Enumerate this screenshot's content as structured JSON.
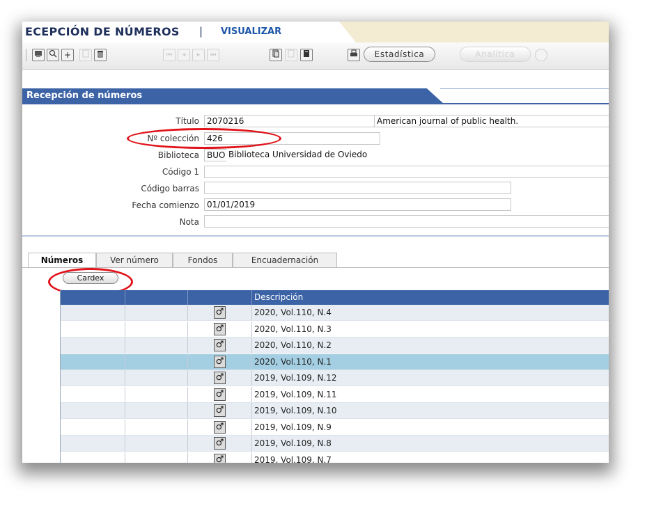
{
  "header": {
    "title": "ECEPCIÓN DE NÚMEROS",
    "separator": "|",
    "section_tab": "VISUALIZAR"
  },
  "toolbar": {
    "icons": [
      "screen-icon",
      "search-icon",
      "plus-icon",
      "doc-icon",
      "trash-icon",
      "first-icon",
      "prev-icon",
      "next-icon",
      "last-icon",
      "copy-icon",
      "doc2-icon",
      "book-icon",
      "print-icon"
    ],
    "glyphs": {
      "plus": "+",
      "first": "⏮",
      "prev": "◂",
      "next": "▸",
      "last": "⏭"
    },
    "estadistica_label": "Estadística",
    "analitica_label": "Analítica"
  },
  "section": {
    "title": "Recepción de números"
  },
  "form": {
    "titulo_label": "Título",
    "titulo_code": "2070216",
    "titulo_value": "American journal of public health.",
    "coleccion_label": "Nº colección",
    "coleccion_value": "426",
    "biblioteca_label": "Biblioteca",
    "biblioteca_code": "BUO",
    "biblioteca_value": "Biblioteca Universidad de Oviedo",
    "codigo1_label": "Código 1",
    "codigo1_value": "",
    "codigo_barras_label": "Código barras",
    "codigo_barras_value": "",
    "fecha_label": "Fecha comienzo",
    "fecha_value": "01/01/2019",
    "nota_label": "Nota",
    "nota_value": ""
  },
  "tabs": [
    {
      "label": "Números",
      "active": true
    },
    {
      "label": "Ver número",
      "active": false
    },
    {
      "label": "Fondos",
      "active": false
    },
    {
      "label": "Encuadernación",
      "active": false
    }
  ],
  "cardex_label": "Cardex",
  "grid": {
    "header": "Descripción",
    "icon": "edit-issue-icon",
    "icon_glyph": "♂",
    "rows": [
      {
        "desc": "2020, Vol.110, N.4",
        "selected": false
      },
      {
        "desc": "2020, Vol.110, N.3",
        "selected": false
      },
      {
        "desc": "2020, Vol.110, N.2",
        "selected": false
      },
      {
        "desc": "2020, Vol.110, N.1",
        "selected": true
      },
      {
        "desc": "2019, Vol.109, N.12",
        "selected": false
      },
      {
        "desc": "2019, Vol.109, N.11",
        "selected": false
      },
      {
        "desc": "2019, Vol.109, N.10",
        "selected": false
      },
      {
        "desc": "2019, Vol.109, N.9",
        "selected": false
      },
      {
        "desc": "2019, Vol.109, N.8",
        "selected": false
      },
      {
        "desc": "2019, Vol.109, N.7",
        "selected": false
      }
    ]
  },
  "colors": {
    "accent": "#3b63a6",
    "selected_row": "#a4cfe3",
    "alt_row": "#e8edf3",
    "highlight": "#e1141b"
  }
}
